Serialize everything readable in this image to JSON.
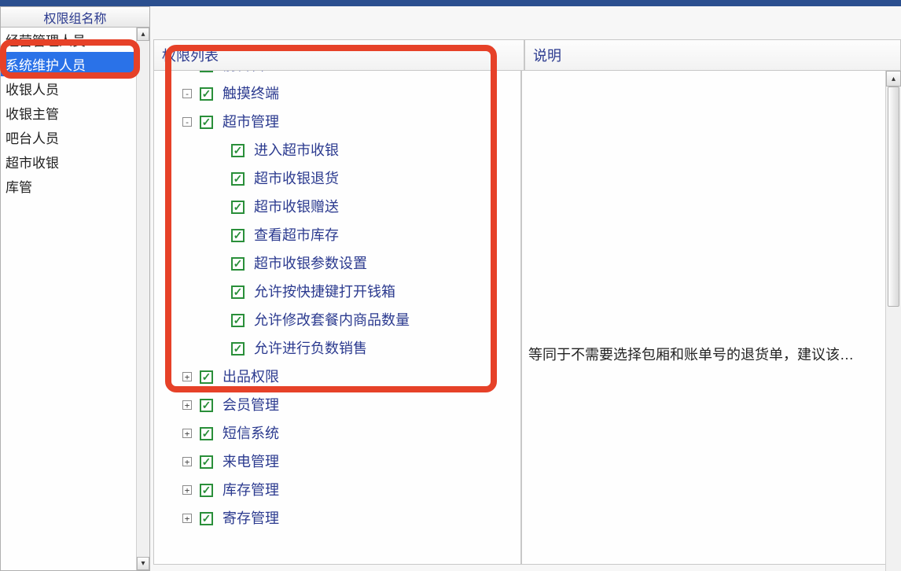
{
  "sidebar": {
    "header": "权限组名称",
    "items": [
      "经营管理人员",
      "系统维护人员",
      "收银人员",
      "收银主管",
      "吧台人员",
      "超市收银",
      "库管"
    ],
    "selectedIndex": 1
  },
  "columns": {
    "tree": "权限列表",
    "desc": "说明"
  },
  "tree": [
    {
      "level": 0,
      "expander": "-",
      "checked": true,
      "label": "前台营业"
    },
    {
      "level": 0,
      "expander": "-",
      "checked": true,
      "label": "触摸终端"
    },
    {
      "level": 0,
      "expander": "-",
      "checked": true,
      "label": "超市管理"
    },
    {
      "level": 1,
      "expander": "",
      "checked": true,
      "label": "进入超市收银"
    },
    {
      "level": 1,
      "expander": "",
      "checked": true,
      "label": "超市收银退货"
    },
    {
      "level": 1,
      "expander": "",
      "checked": true,
      "label": "超市收银赠送"
    },
    {
      "level": 1,
      "expander": "",
      "checked": true,
      "label": "查看超市库存"
    },
    {
      "level": 1,
      "expander": "",
      "checked": true,
      "label": "超市收银参数设置"
    },
    {
      "level": 1,
      "expander": "",
      "checked": true,
      "label": "允许按快捷键打开钱箱"
    },
    {
      "level": 1,
      "expander": "",
      "checked": true,
      "label": "允许修改套餐内商品数量"
    },
    {
      "level": 1,
      "expander": "",
      "checked": true,
      "label": "允许进行负数销售"
    },
    {
      "level": 0,
      "expander": "+",
      "checked": true,
      "label": "出品权限"
    },
    {
      "level": 0,
      "expander": "+",
      "checked": true,
      "label": "会员管理"
    },
    {
      "level": 0,
      "expander": "+",
      "checked": true,
      "label": "短信系统"
    },
    {
      "level": 0,
      "expander": "+",
      "checked": true,
      "label": "来电管理"
    },
    {
      "level": 0,
      "expander": "+",
      "checked": true,
      "label": "库存管理"
    },
    {
      "level": 0,
      "expander": "+",
      "checked": true,
      "label": "寄存管理"
    }
  ],
  "descriptions": {
    "row10": "等同于不需要选择包厢和账单号的退货单，建议该…"
  },
  "highlights": {
    "color": "#e64128"
  }
}
